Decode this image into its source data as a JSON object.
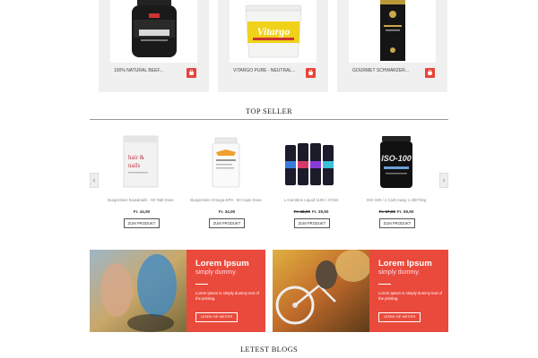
{
  "top_products": [
    {
      "name": "100% NATURAL BEEF...",
      "image": "beef-protein-tub"
    },
    {
      "name": "VITARGO PURE - NEUTRAL...",
      "image": "vitargo-tub"
    },
    {
      "name": "GOURMET SCHWARZER...",
      "image": "black-coffee-box"
    }
  ],
  "top_seller": {
    "title": "TOP SELLER",
    "products": [
      {
        "name": "Burgerstein haut&nails · 90 Tabl Dose",
        "old_price": "",
        "price": "Fr. 44,90",
        "button": "ZUM PRODUKT",
        "image": "hair-nails-box"
      },
      {
        "name": "Burgerstein Omega-EPA · 50 Caps Dose",
        "old_price": "",
        "price": "Fr. 34,90",
        "button": "ZUM PRODUKT",
        "image": "omega-bottle"
      },
      {
        "name": "L-Carnitine Liquid 1100 / 473ml",
        "old_price": "Fr. 48,90",
        "price": "Fr. 39,90",
        "button": "ZUM PRODUKT",
        "image": "carnitine-bottles"
      },
      {
        "name": "ISO-100 / 1 Carb Away 1.4lb/726g",
        "old_price": "Fr. 67,00",
        "price": "Fr. 59,90",
        "button": "ZUM PRODUKT",
        "image": "iso100-tub"
      }
    ]
  },
  "banners": [
    {
      "title": "Lorem Ipsum",
      "subtitle": "simply dummy.",
      "text": "Lorem Ipsum is simply dummy text of the printing.",
      "button": "LESEN SIE WEITER",
      "photo": "runners-photo"
    },
    {
      "title": "Lorem Ipsum",
      "subtitle": "simply dummy.",
      "text": "Lorem Ipsum is simply dummy text of the printing.",
      "button": "LESEN SIE WEITER",
      "photo": "cyclist-photo"
    }
  ],
  "blogs": {
    "title": "LETEST BLOGS"
  },
  "colors": {
    "accent": "#e8443a",
    "banner_panel": "#ea4a3c"
  }
}
